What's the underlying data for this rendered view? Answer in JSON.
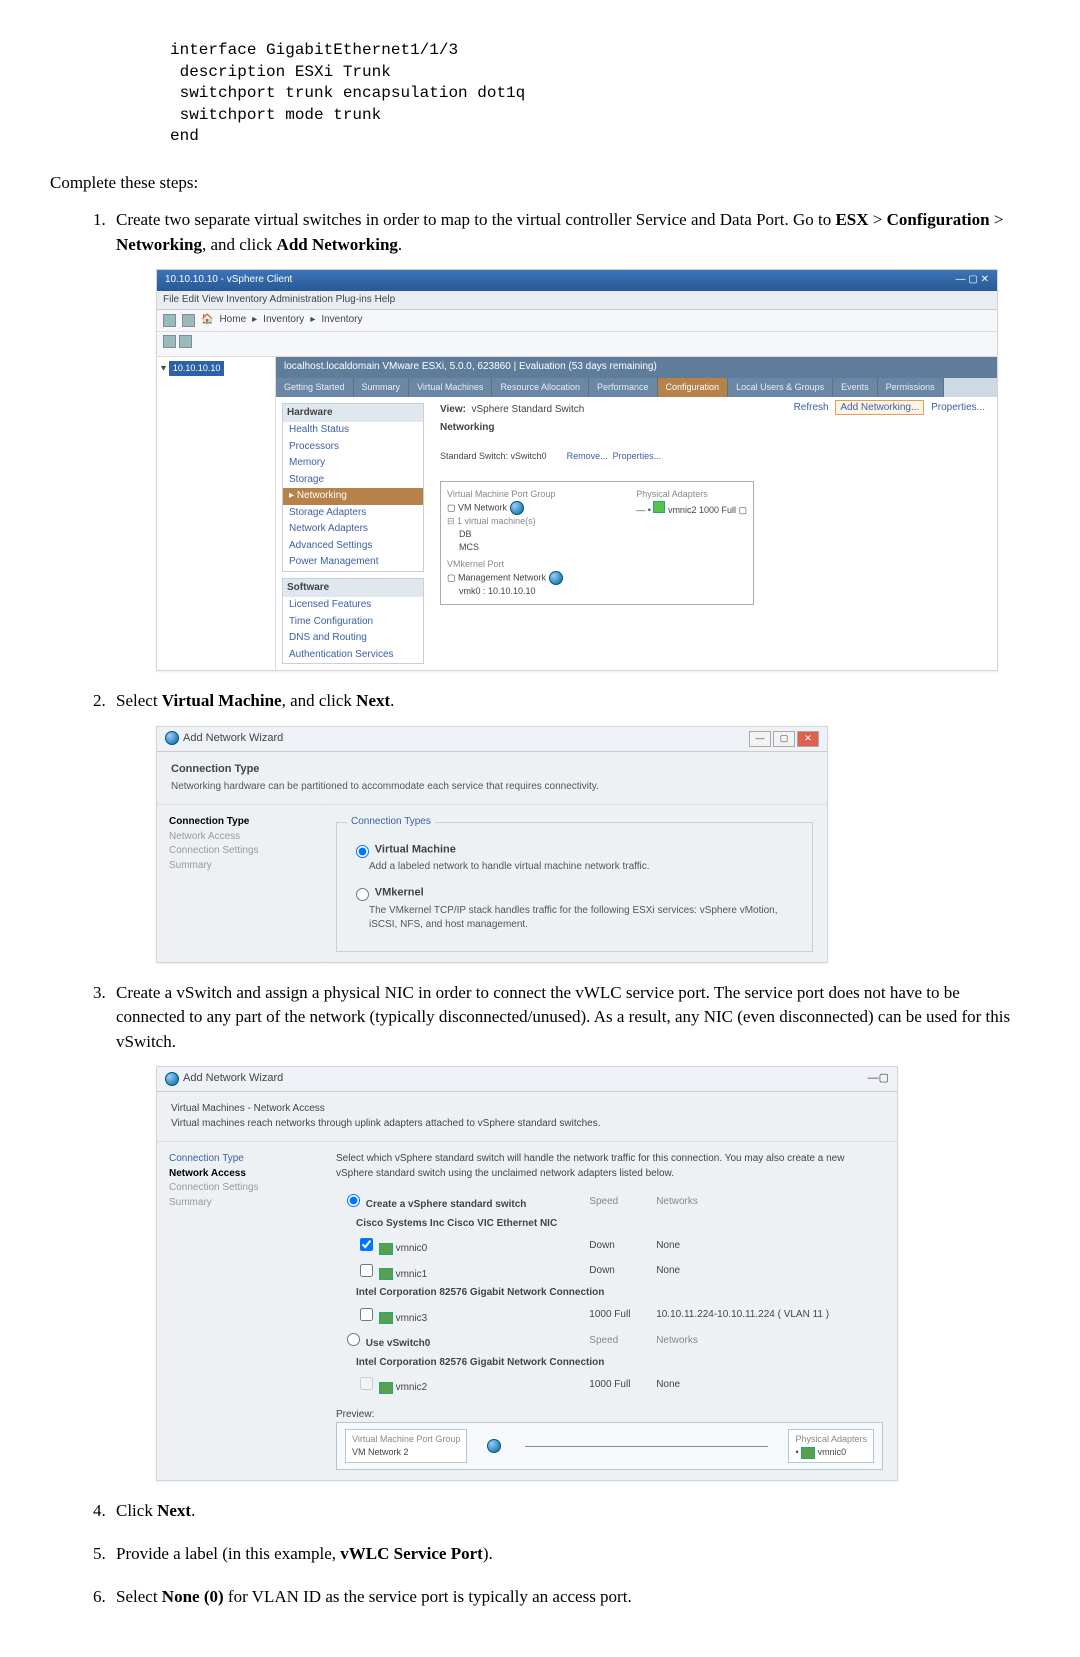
{
  "code": "interface GigabitEthernet1/1/3\n description ESXi Trunk\n switchport trunk encapsulation dot1q\n switchport mode trunk\nend",
  "lead": "Complete these steps:",
  "steps": {
    "s1a": "Create two separate virtual switches in order to map to the virtual controller Service and Data Port. Go to ",
    "s1p": [
      "ESX",
      " > ",
      "Configuration",
      " > ",
      "Networking",
      ", and click ",
      "Add Networking",
      "."
    ],
    "s2": "Select ",
    "s2b": "Virtual Machine",
    "s2c": ", and click ",
    "s2d": "Next",
    "s2e": ".",
    "s3": "Create a vSwitch and assign a physical NIC in order to connect the vWLC service port. The service port does not have to be connected to any part of the network (typically disconnected/unused). As a result, any NIC (even disconnected) can be used for this vSwitch.",
    "s4a": "Click ",
    "s4b": "Next",
    "s4c": ".",
    "s5a": "Provide a label (in this example, ",
    "s5b": "vWLC Service Port",
    "s5c": ").",
    "s6a": "Select ",
    "s6b": "None (0)",
    "s6c": " for VLAN ID as the service port is typically an access port."
  },
  "sc1": {
    "title": "10.10.10.10 - vSphere Client",
    "menu": "File  Edit  View  Inventory  Administration  Plug-ins  Help",
    "crumb_home": "Home",
    "crumb_inv": "Inventory",
    "crumb_inv2": "Inventory",
    "treehost": "10.10.10.10",
    "hosthdr": "localhost.localdomain VMware ESXi, 5.0.0, 623860 | Evaluation (53 days remaining)",
    "tabs": [
      "Getting Started",
      "Summary",
      "Virtual Machines",
      "Resource Allocation",
      "Performance",
      "Configuration",
      "Local Users & Groups",
      "Events",
      "Permissions"
    ],
    "hw_head": "Hardware",
    "hw_items": [
      "Health Status",
      "Processors",
      "Memory",
      "Storage",
      "Networking",
      "Storage Adapters",
      "Network Adapters",
      "Advanced Settings",
      "Power Management"
    ],
    "sw_head": "Software",
    "sw_items": [
      "Licensed Features",
      "Time Configuration",
      "DNS and Routing",
      "Authentication Services"
    ],
    "view_lbl": "View:",
    "view_val": "vSphere Standard Switch",
    "net_lbl": "Networking",
    "links": {
      "refresh": "Refresh",
      "add": "Add Networking...",
      "props": "Properties..."
    },
    "sw_title": "Standard Switch: vSwitch0",
    "sw_links": {
      "remove": "Remove...",
      "props": "Properties..."
    },
    "vm_pg_lbl": "Virtual Machine Port Group",
    "vm_pg": "VM Network",
    "phys_lbl": "Physical Adapters",
    "phys_nic": "vmnic2  1000  Full",
    "vm_count": "1 virtual machine(s)",
    "vmk_pg_lbl": "VMkernel Port",
    "vmk_pg": "Management Network",
    "vmk_ip": "vmk0 : 10.10.10.10",
    "guests": [
      "DB",
      "MCS"
    ]
  },
  "sc2": {
    "title": "Add Network Wizard",
    "sec_head": "Connection Type",
    "sec_sub": "Networking hardware can be partitioned to accommodate each service that requires connectivity.",
    "side": [
      "Connection Type",
      "Network Access",
      "Connection Settings",
      "Summary"
    ],
    "legend": "Connection Types",
    "opt1_lbl": "Virtual Machine",
    "opt1_desc": "Add a labeled network to handle virtual machine network traffic.",
    "opt2_lbl": "VMkernel",
    "opt2_desc": "The VMkernel TCP/IP stack handles traffic for the following ESXi services: vSphere vMotion, iSCSI, NFS, and host management."
  },
  "sc3": {
    "title": "Add Network Wizard",
    "sec_head": "Virtual Machines - Network Access",
    "sec_sub": "Virtual machines reach networks through uplink adapters attached to vSphere standard switches.",
    "side": [
      "Connection Type",
      "Network Access",
      "Connection Settings",
      "Summary"
    ],
    "intro": "Select which vSphere standard switch will handle the network traffic for this connection. You may also create a new vSphere standard switch using the unclaimed network adapters listed below.",
    "opt_create": "Create a vSphere standard switch",
    "grp1": "Cisco Systems Inc Cisco VIC Ethernet NIC",
    "grp2": "Intel Corporation 82576 Gigabit Network Connection",
    "opt_use": "Use vSwitch0",
    "cols": {
      "speed": "Speed",
      "net": "Networks"
    },
    "nics": {
      "n0": {
        "name": "vmnic0",
        "speed": "Down",
        "net": "None"
      },
      "n1": {
        "name": "vmnic1",
        "speed": "Down",
        "net": "None"
      },
      "n3": {
        "name": "vmnic3",
        "speed": "1000 Full",
        "net": "10.10.11.224-10.10.11.224 ( VLAN 11 )"
      },
      "n2": {
        "name": "vmnic2",
        "speed": "1000 Full",
        "net": "None"
      }
    },
    "preview_lbl": "Preview:",
    "pg_lbl": "Virtual Machine Port Group",
    "pg_name": "VM Network 2",
    "phys_lbl": "Physical Adapters",
    "phys_nic": "vmnic0"
  }
}
